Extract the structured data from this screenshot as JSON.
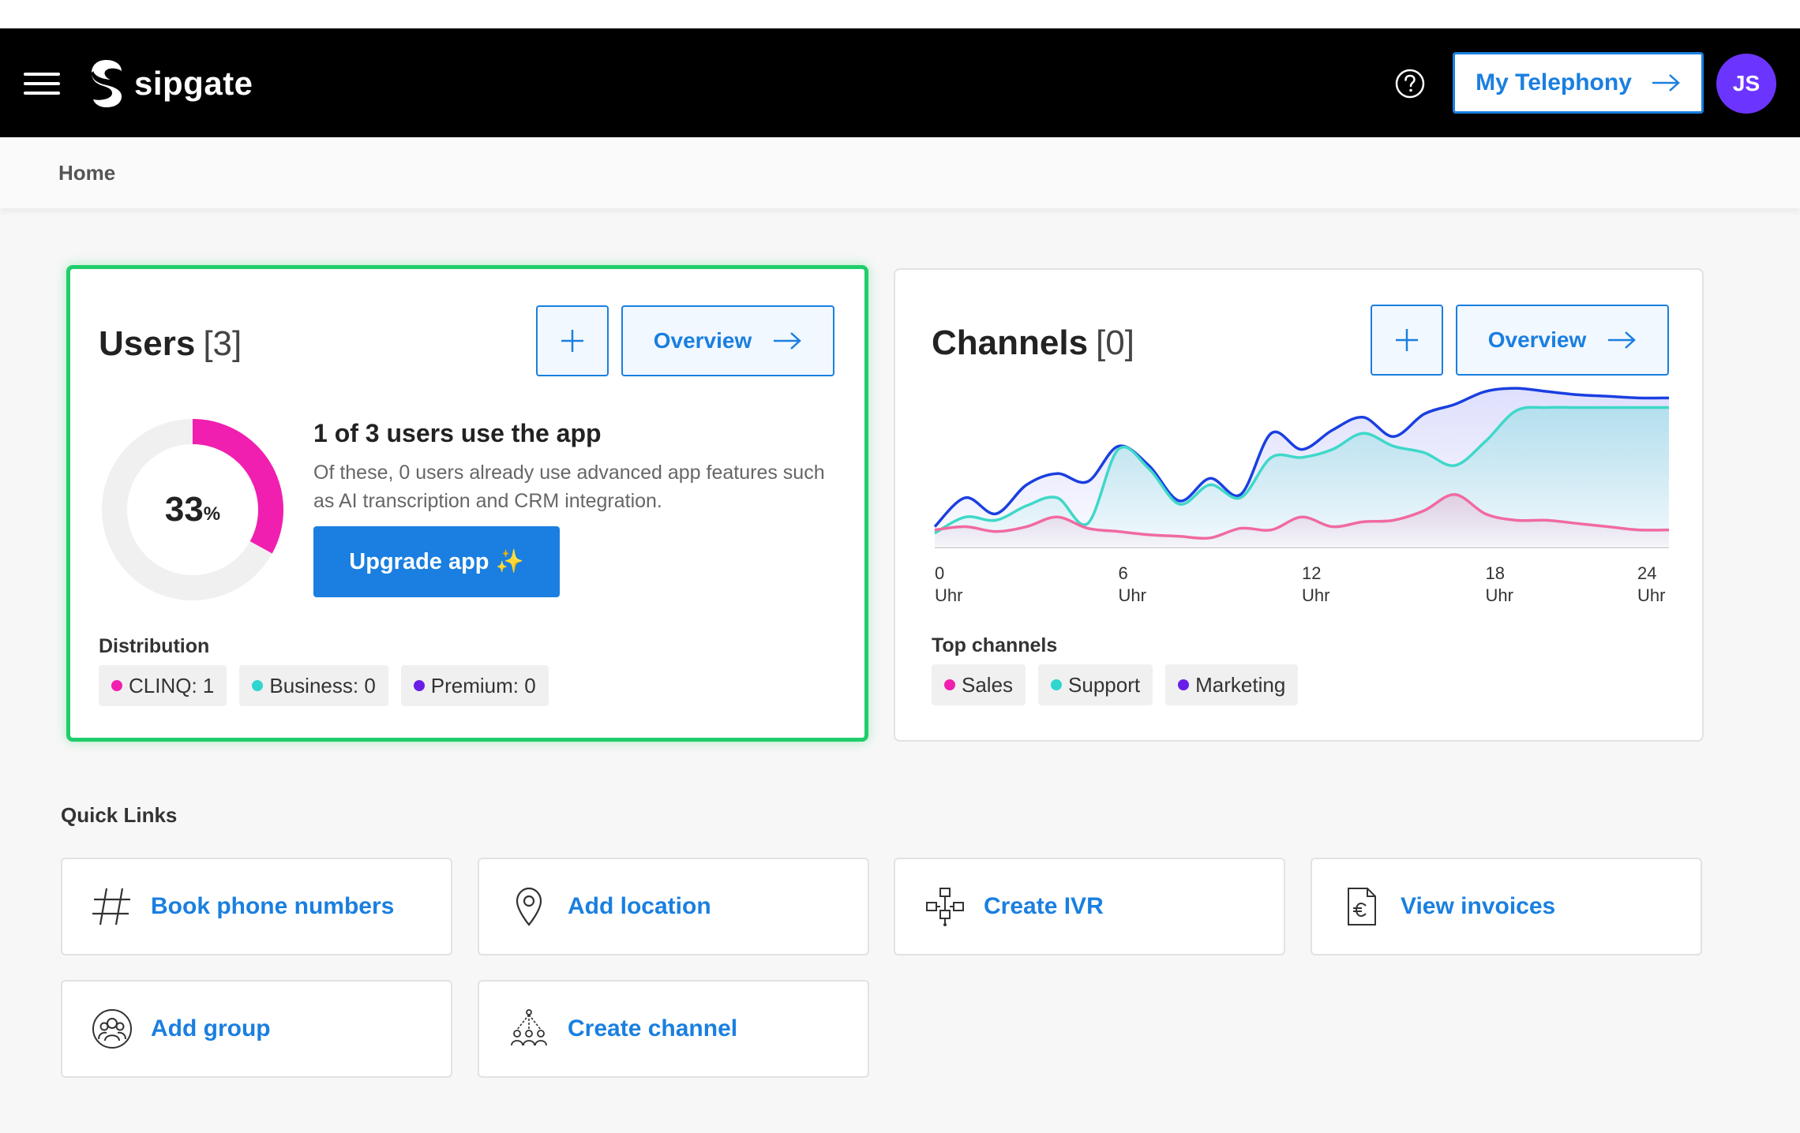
{
  "header": {
    "logo_text": "sipgate",
    "telephony_button": "My Telephony",
    "avatar_initials": "JS"
  },
  "breadcrumb": "Home",
  "users_card": {
    "title": "Users",
    "count": "[3]",
    "overview": "Overview",
    "percent_value": "33",
    "percent_unit": "%",
    "usage_fraction": 0.33,
    "usage_title": "1 of 3 users use the app",
    "usage_desc": "Of these, 0 users already use advanced app features such as AI transcription and CRM integration.",
    "upgrade_button": "Upgrade app ✨",
    "distribution_label": "Distribution",
    "chips": [
      {
        "label": "CLINQ: 1",
        "color": "#f01fb0"
      },
      {
        "label": "Business: 0",
        "color": "#2fd6d0"
      },
      {
        "label": "Premium: 0",
        "color": "#6a1fe8"
      }
    ]
  },
  "channels_card": {
    "title": "Channels",
    "count": "[0]",
    "overview": "Overview",
    "top_label": "Top channels",
    "chips": [
      {
        "label": "Sales",
        "color": "#f01fb0"
      },
      {
        "label": "Support",
        "color": "#2fd6d0"
      },
      {
        "label": "Marketing",
        "color": "#6a1fe8"
      }
    ]
  },
  "chart_data": {
    "type": "area",
    "x": [
      0,
      1,
      2,
      3,
      4,
      5,
      6,
      7,
      8,
      9,
      10,
      11,
      12,
      13,
      14,
      15,
      16,
      17,
      18,
      19,
      20,
      21,
      22,
      23,
      24
    ],
    "tick_labels": [
      {
        "x": 0,
        "num": "0",
        "unit": "Uhr"
      },
      {
        "x": 6,
        "num": "6",
        "unit": "Uhr"
      },
      {
        "x": 12,
        "num": "12",
        "unit": "Uhr"
      },
      {
        "x": 18,
        "num": "18",
        "unit": "Uhr"
      },
      {
        "x": 24,
        "num": "24",
        "unit": "Uhr"
      }
    ],
    "ylim": [
      0,
      100
    ],
    "series": [
      {
        "color": "#1a3fe0",
        "values": [
          12,
          30,
          20,
          38,
          45,
          40,
          62,
          50,
          28,
          42,
          32,
          70,
          60,
          72,
          80,
          68,
          82,
          88,
          96,
          98,
          96,
          94,
          93,
          92,
          92
        ]
      },
      {
        "color": "#3fd8c8",
        "values": [
          8,
          18,
          16,
          25,
          30,
          14,
          60,
          48,
          26,
          38,
          30,
          55,
          55,
          60,
          70,
          62,
          58,
          50,
          65,
          84,
          86,
          86,
          86,
          86,
          86
        ]
      },
      {
        "color": "#f06aa0",
        "values": [
          10,
          12,
          9,
          12,
          18,
          11,
          9,
          7,
          6,
          5,
          11,
          10,
          18,
          12,
          15,
          16,
          22,
          32,
          20,
          16,
          16,
          14,
          12,
          10,
          10
        ]
      }
    ]
  },
  "quick_links": {
    "title": "Quick Links",
    "items": [
      {
        "label": "Book phone numbers",
        "icon": "hash-icon"
      },
      {
        "label": "Add location",
        "icon": "location-pin-icon"
      },
      {
        "label": "Create IVR",
        "icon": "ivr-flow-icon"
      },
      {
        "label": "View invoices",
        "icon": "invoice-euro-icon"
      },
      {
        "label": "Add group",
        "icon": "group-icon"
      },
      {
        "label": "Create channel",
        "icon": "channel-people-icon"
      }
    ]
  }
}
